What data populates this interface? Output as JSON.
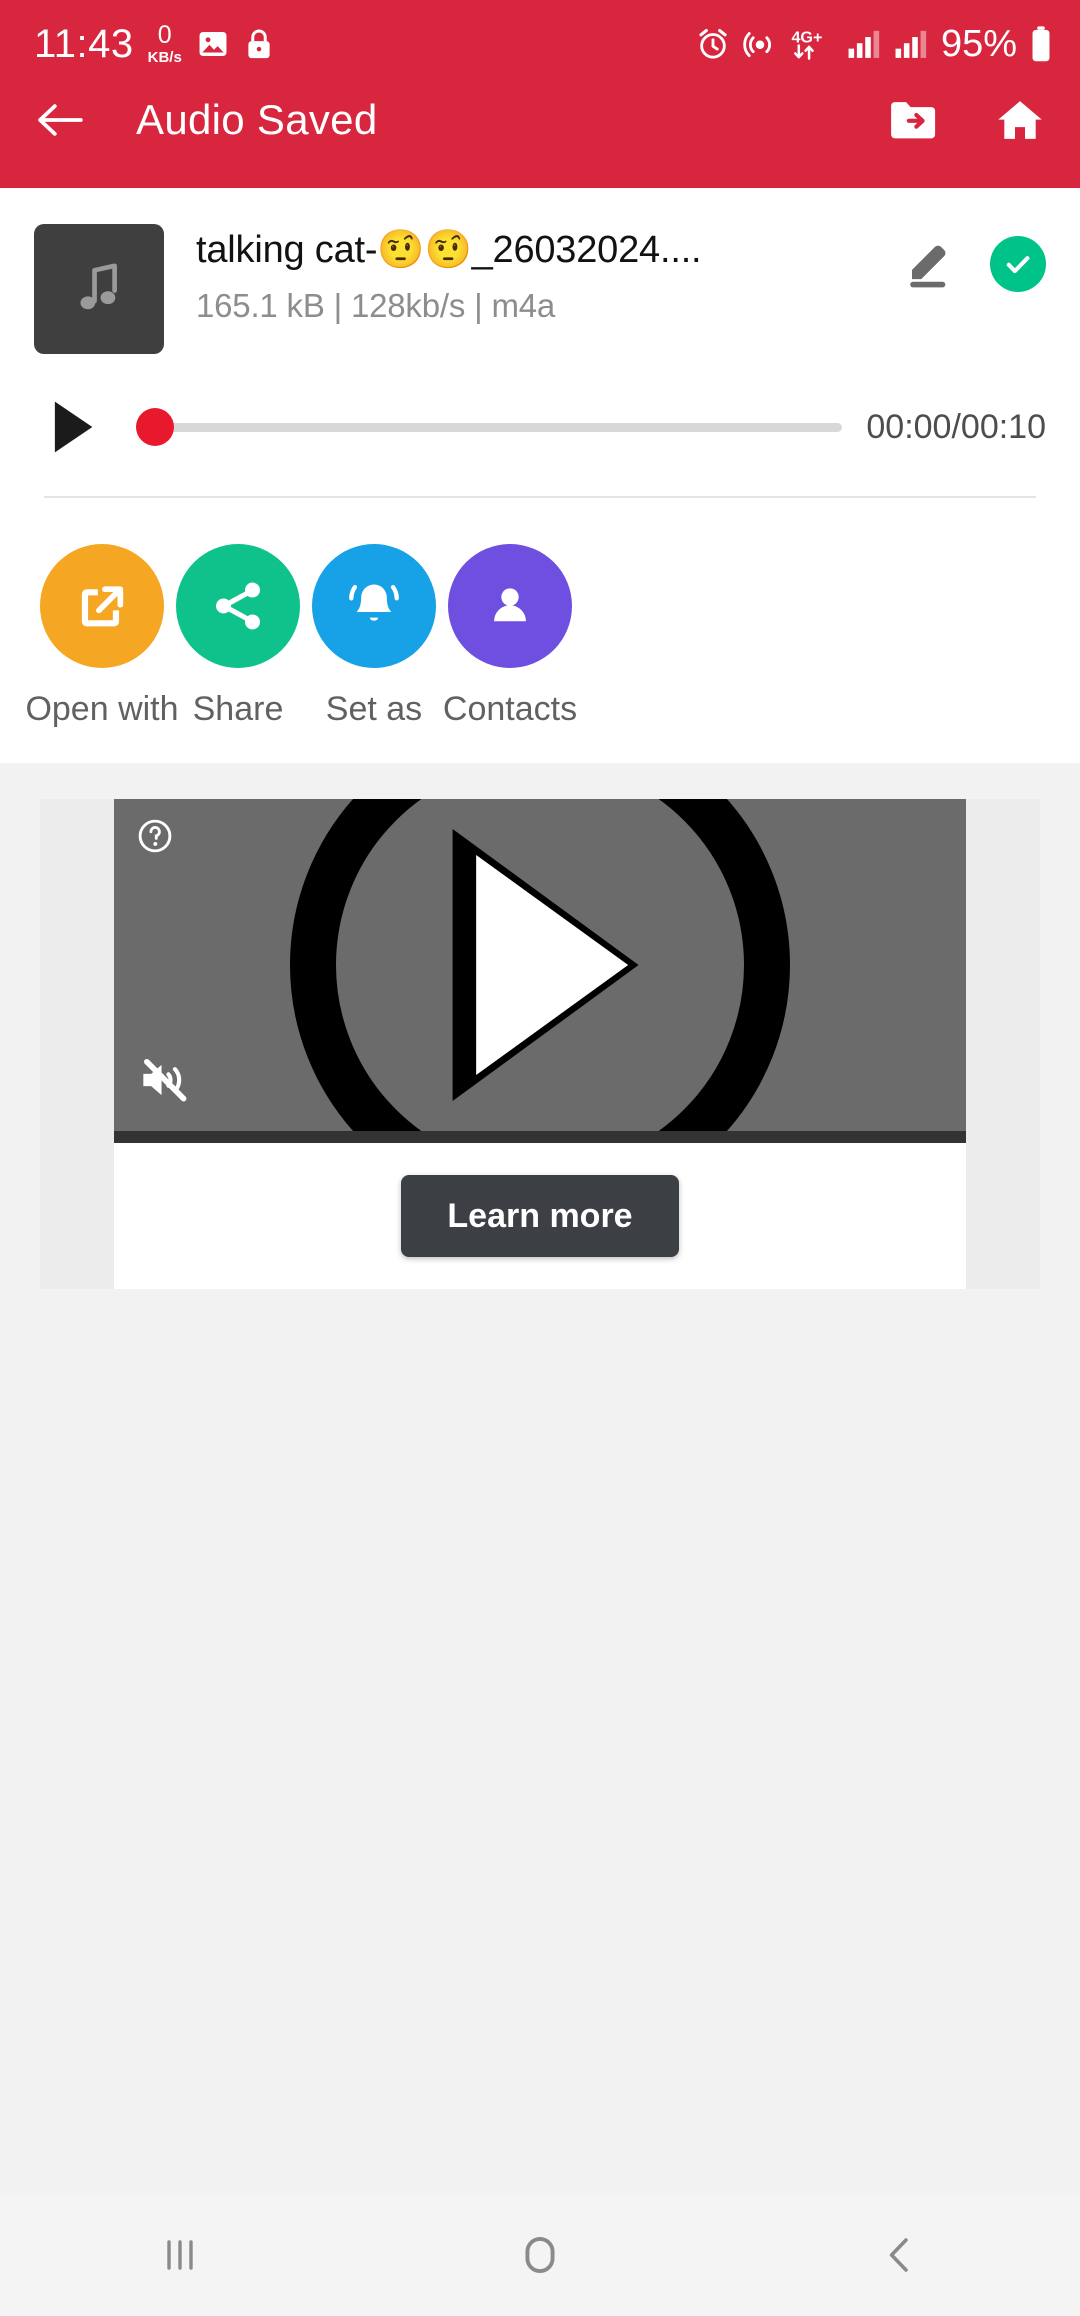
{
  "status_bar": {
    "time": "11:43",
    "net_speed_value": "0",
    "net_speed_unit": "KB/s",
    "battery": "95%",
    "network_type": "4G+",
    "icons": [
      "image-icon",
      "lock-icon",
      "alarm-icon",
      "hotspot-icon",
      "data-transfer-icon",
      "signal-bars-icon",
      "signal-bars-icon-2",
      "battery-icon"
    ]
  },
  "app_bar": {
    "title": "Audio Saved",
    "back_icon": "back-arrow-icon",
    "folder_icon": "folder-move-icon",
    "home_icon": "home-icon"
  },
  "file": {
    "name": "talking cat-🤨🤨_26032024....",
    "size": "165.1 kB",
    "bitrate": "128kb/s",
    "format": "m4a",
    "meta_line": "165.1 kB | 128kb/s | m4a",
    "thumb_icon": "music-note-icon",
    "edit_icon": "pencil-edit-icon",
    "status_icon": "check-circle-icon",
    "status_color": "#00c389"
  },
  "player": {
    "play_icon": "play-icon",
    "current_time": "00:00",
    "total_time": "00:10",
    "time_display": "00:00/00:10",
    "progress_percent": 0,
    "thumb_color": "#e8192c",
    "track_color": "#d8d8d8"
  },
  "actions": [
    {
      "label": "Open with",
      "icon": "open-external-icon",
      "color": "#f5a623"
    },
    {
      "label": "Share",
      "icon": "share-icon",
      "color": "#0fc18a"
    },
    {
      "label": "Set as",
      "icon": "bell-icon",
      "color": "#17a1e6"
    },
    {
      "label": "Contacts",
      "icon": "person-icon",
      "color": "#6e4fe0"
    }
  ],
  "ad": {
    "info_icon": "ad-info-question-icon",
    "mute_icon": "mute-icon",
    "play_icon": "play-icon",
    "cta_label": "Learn more"
  },
  "nav_bar": {
    "recents_icon": "recents-icon",
    "home_icon": "home-circle-icon",
    "back_icon": "back-chevron-icon"
  },
  "theme": {
    "primary": "#d9263f",
    "background": "#f2f2f2",
    "card": "#ffffff"
  }
}
